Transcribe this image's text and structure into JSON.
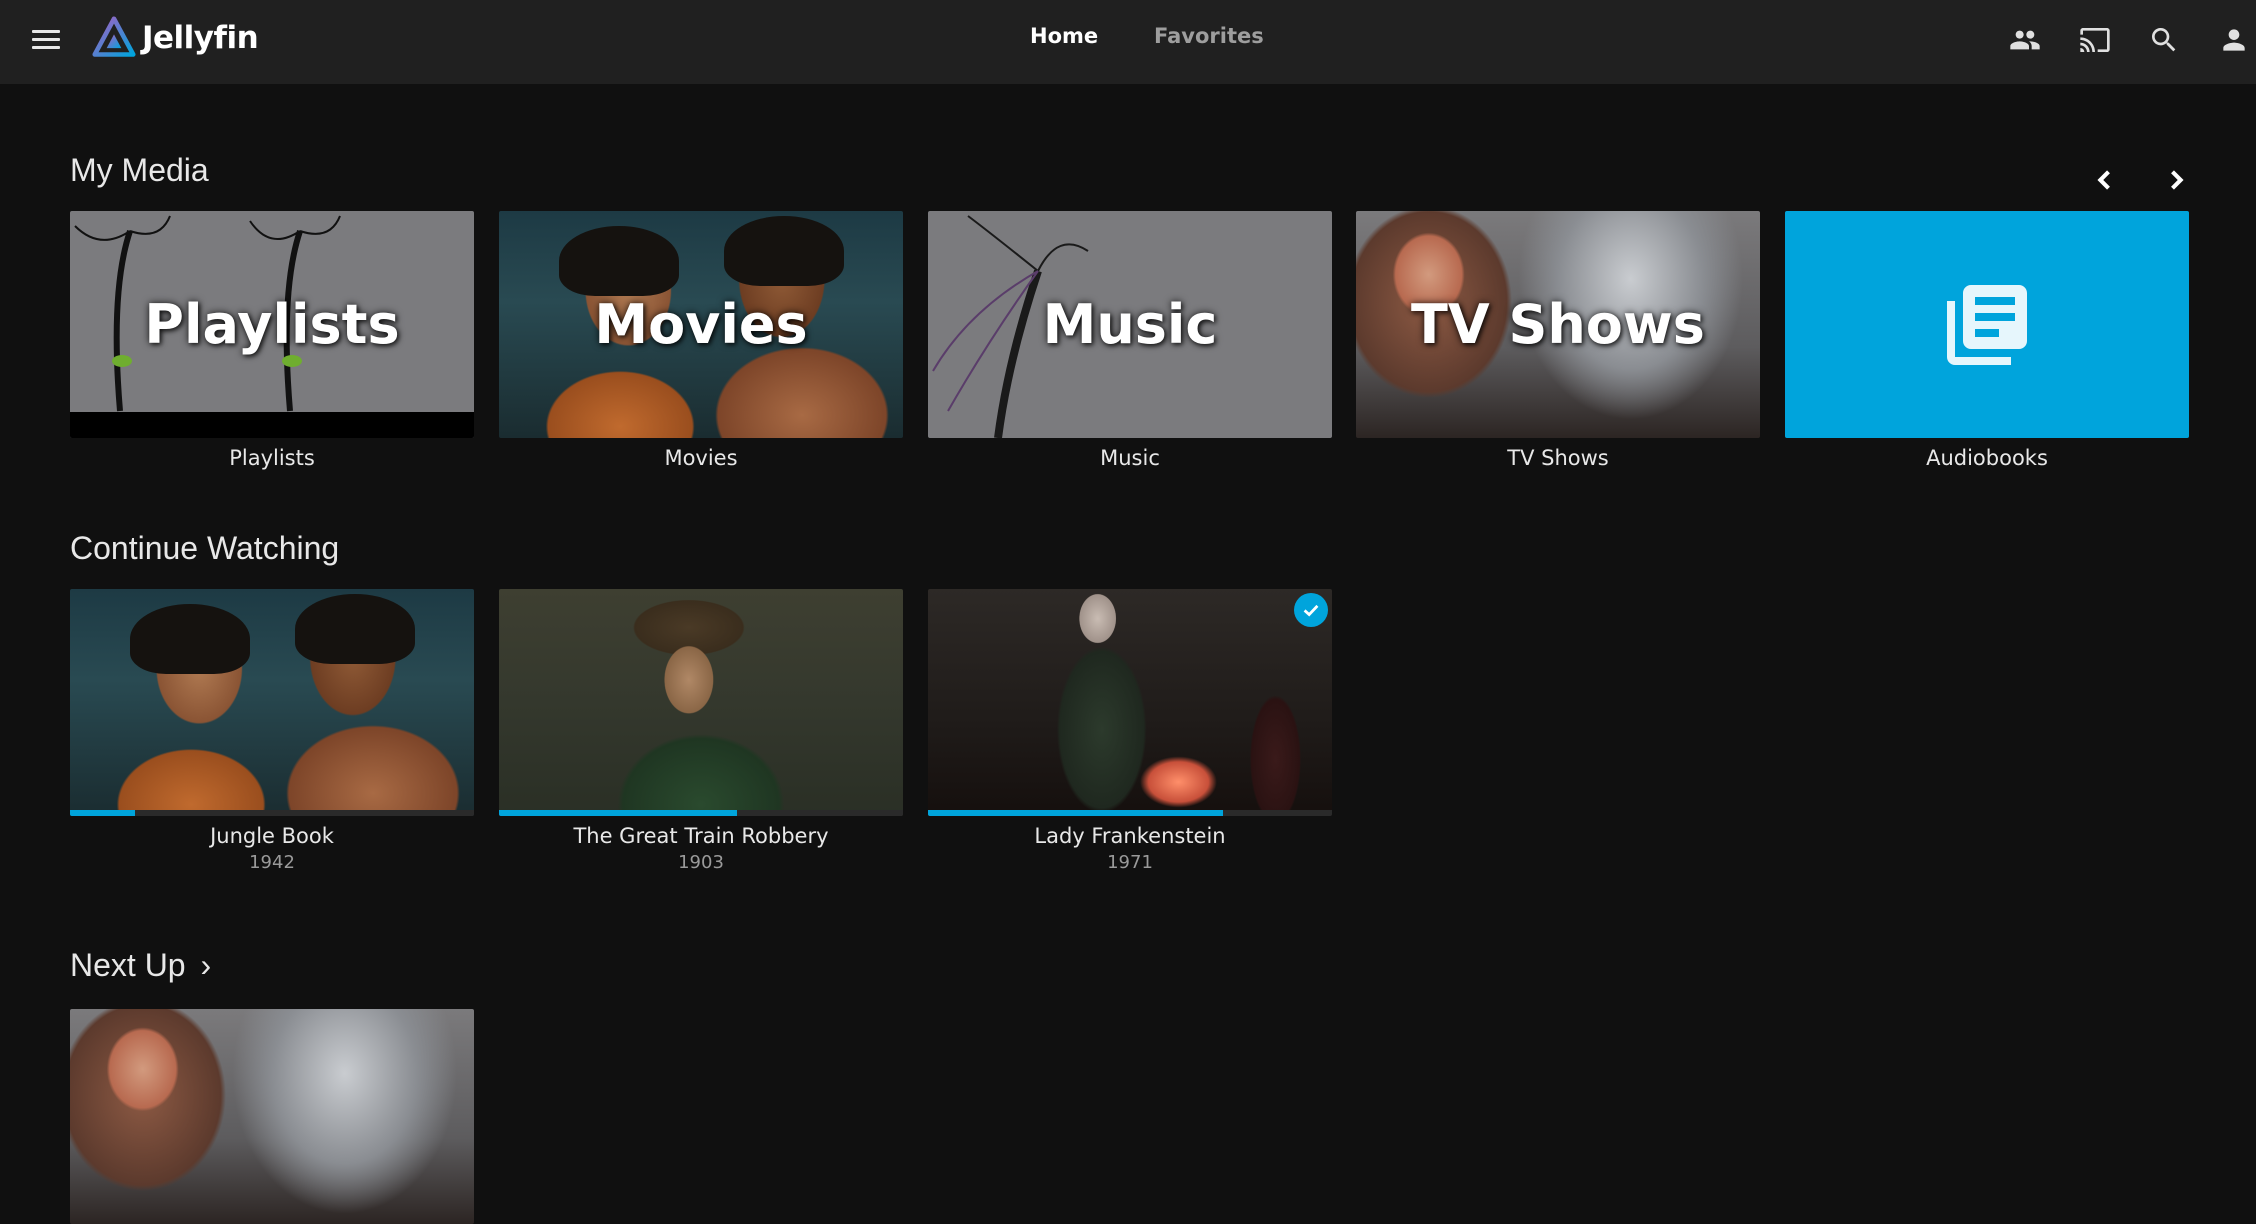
{
  "header": {
    "app_name": "Jellyfin",
    "tabs": [
      {
        "label": "Home",
        "active": true
      },
      {
        "label": "Favorites",
        "active": false
      }
    ],
    "icons": [
      "syncplay-icon",
      "cast-icon",
      "search-icon",
      "user-icon"
    ]
  },
  "colors": {
    "accent": "#00a4dc",
    "background": "#101010",
    "header": "#202020"
  },
  "sections": {
    "my_media": {
      "title": "My Media",
      "items": [
        {
          "label": "Playlists",
          "overlay": "Playlists"
        },
        {
          "label": "Movies",
          "overlay": "Movies"
        },
        {
          "label": "Music",
          "overlay": "Music"
        },
        {
          "label": "TV Shows",
          "overlay": "TV Shows"
        },
        {
          "label": "Audiobooks",
          "icon": "book-icon"
        }
      ]
    },
    "continue_watching": {
      "title": "Continue Watching",
      "items": [
        {
          "title": "Jungle Book",
          "year": "1942",
          "progress": 0.16,
          "played": false
        },
        {
          "title": "The Great Train Robbery",
          "year": "1903",
          "progress": 0.59,
          "played": false
        },
        {
          "title": "Lady Frankenstein",
          "year": "1971",
          "progress": 0.73,
          "played": true
        }
      ]
    },
    "next_up": {
      "title": "Next Up",
      "chevron": "›"
    }
  }
}
